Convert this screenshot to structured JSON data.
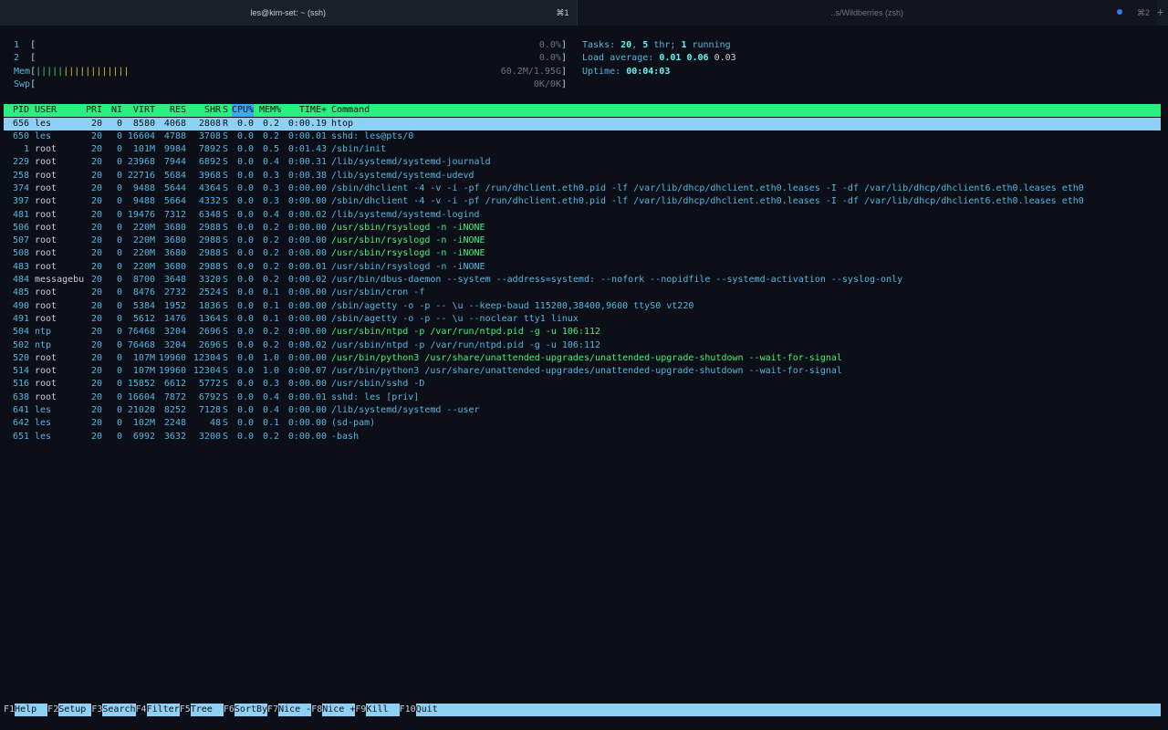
{
  "window": {
    "tabs": [
      {
        "title": "les@kim-set: ~ (ssh)",
        "shortcut": "⌘1"
      },
      {
        "title": "..s/Wildberries (zsh)",
        "shortcut": "⌘2"
      }
    ],
    "new_tab": "+"
  },
  "meters": {
    "cpu1": {
      "label": "1",
      "open": "[",
      "bar": "",
      "value": "0.0%",
      "close": "]"
    },
    "cpu2": {
      "label": "2",
      "open": "[",
      "bar": "",
      "value": "0.0%",
      "close": "]"
    },
    "mem": {
      "label": "Mem",
      "open": "[",
      "bar_green": "|||||",
      "bar_yellow": "||||||||||||",
      "value": "60.2M/1.95G",
      "close": "]"
    },
    "swp": {
      "label": "Swp",
      "open": "[",
      "bar": "",
      "value": "0K/0K",
      "close": "]"
    }
  },
  "stats": {
    "tasks_label": "Tasks:",
    "tasks": "20",
    "thr": "5",
    "thr_label": "thr;",
    "running": "1",
    "running_label": "running",
    "load_label": "Load average:",
    "load1": "0.01",
    "load5": "0.06",
    "load15": "0.03",
    "uptime_label": "Uptime:",
    "uptime": "00:04:03"
  },
  "columns": {
    "pid": "PID",
    "user": "USER",
    "pri": "PRI",
    "ni": "NI",
    "virt": "VIRT",
    "res": "RES",
    "shr": "SHR",
    "s": "S",
    "cpu": "CPU%",
    "mem": "MEM%",
    "time": "TIME+",
    "cmd": "Command"
  },
  "processes": [
    {
      "pid": "656",
      "user": "les",
      "pri": "20",
      "ni": "0",
      "virt": "8580",
      "res": "4068",
      "shr": "2808",
      "s": "R",
      "cpu": "0.0",
      "mem": "0.2",
      "time": "0:00.19",
      "cmd": "htop",
      "style": "selected"
    },
    {
      "pid": "650",
      "user": "les",
      "pri": "20",
      "ni": "0",
      "virt": "16604",
      "res": "4788",
      "shr": "3708",
      "s": "S",
      "cpu": "0.0",
      "mem": "0.2",
      "time": "0:00.01",
      "cmd": "sshd: les@pts/0",
      "style": "normal"
    },
    {
      "pid": "1",
      "user": "root",
      "pri": "20",
      "ni": "0",
      "virt": "101M",
      "res": "9984",
      "shr": "7892",
      "s": "S",
      "cpu": "0.0",
      "mem": "0.5",
      "time": "0:01.43",
      "cmd": "/sbin/init",
      "style": "normal"
    },
    {
      "pid": "229",
      "user": "root",
      "pri": "20",
      "ni": "0",
      "virt": "23968",
      "res": "7944",
      "shr": "6892",
      "s": "S",
      "cpu": "0.0",
      "mem": "0.4",
      "time": "0:00.31",
      "cmd": "/lib/systemd/systemd-journald",
      "style": "normal"
    },
    {
      "pid": "258",
      "user": "root",
      "pri": "20",
      "ni": "0",
      "virt": "22716",
      "res": "5684",
      "shr": "3968",
      "s": "S",
      "cpu": "0.0",
      "mem": "0.3",
      "time": "0:00.38",
      "cmd": "/lib/systemd/systemd-udevd",
      "style": "normal"
    },
    {
      "pid": "374",
      "user": "root",
      "pri": "20",
      "ni": "0",
      "virt": "9488",
      "res": "5644",
      "shr": "4364",
      "s": "S",
      "cpu": "0.0",
      "mem": "0.3",
      "time": "0:00.00",
      "cmd": "/sbin/dhclient -4 -v -i -pf /run/dhclient.eth0.pid -lf /var/lib/dhcp/dhclient.eth0.leases -I -df /var/lib/dhcp/dhclient6.eth0.leases eth0",
      "style": "normal"
    },
    {
      "pid": "397",
      "user": "root",
      "pri": "20",
      "ni": "0",
      "virt": "9488",
      "res": "5664",
      "shr": "4332",
      "s": "S",
      "cpu": "0.0",
      "mem": "0.3",
      "time": "0:00.00",
      "cmd": "/sbin/dhclient -4 -v -i -pf /run/dhclient.eth0.pid -lf /var/lib/dhcp/dhclient.eth0.leases -I -df /var/lib/dhcp/dhclient6.eth0.leases eth0",
      "style": "normal"
    },
    {
      "pid": "481",
      "user": "root",
      "pri": "20",
      "ni": "0",
      "virt": "19476",
      "res": "7312",
      "shr": "6348",
      "s": "S",
      "cpu": "0.0",
      "mem": "0.4",
      "time": "0:00.02",
      "cmd": "/lib/systemd/systemd-logind",
      "style": "normal"
    },
    {
      "pid": "506",
      "user": "root",
      "pri": "20",
      "ni": "0",
      "virt": "220M",
      "res": "3680",
      "shr": "2988",
      "s": "S",
      "cpu": "0.0",
      "mem": "0.2",
      "time": "0:00.00",
      "cmd": "/usr/sbin/rsyslogd -n -iNONE",
      "style": "thread"
    },
    {
      "pid": "507",
      "user": "root",
      "pri": "20",
      "ni": "0",
      "virt": "220M",
      "res": "3680",
      "shr": "2988",
      "s": "S",
      "cpu": "0.0",
      "mem": "0.2",
      "time": "0:00.00",
      "cmd": "/usr/sbin/rsyslogd -n -iNONE",
      "style": "thread"
    },
    {
      "pid": "508",
      "user": "root",
      "pri": "20",
      "ni": "0",
      "virt": "220M",
      "res": "3680",
      "shr": "2988",
      "s": "S",
      "cpu": "0.0",
      "mem": "0.2",
      "time": "0:00.00",
      "cmd": "/usr/sbin/rsyslogd -n -iNONE",
      "style": "thread"
    },
    {
      "pid": "483",
      "user": "root",
      "pri": "20",
      "ni": "0",
      "virt": "220M",
      "res": "3680",
      "shr": "2988",
      "s": "S",
      "cpu": "0.0",
      "mem": "0.2",
      "time": "0:00.01",
      "cmd": "/usr/sbin/rsyslogd -n -iNONE",
      "style": "normal"
    },
    {
      "pid": "484",
      "user": "messagebu",
      "pri": "20",
      "ni": "0",
      "virt": "8700",
      "res": "3648",
      "shr": "3320",
      "s": "S",
      "cpu": "0.0",
      "mem": "0.2",
      "time": "0:00.02",
      "cmd": "/usr/bin/dbus-daemon --system --address=systemd: --nofork --nopidfile --systemd-activation --syslog-only",
      "style": "normal"
    },
    {
      "pid": "485",
      "user": "root",
      "pri": "20",
      "ni": "0",
      "virt": "8476",
      "res": "2732",
      "shr": "2524",
      "s": "S",
      "cpu": "0.0",
      "mem": "0.1",
      "time": "0:00.00",
      "cmd": "/usr/sbin/cron -f",
      "style": "normal"
    },
    {
      "pid": "490",
      "user": "root",
      "pri": "20",
      "ni": "0",
      "virt": "5384",
      "res": "1952",
      "shr": "1836",
      "s": "S",
      "cpu": "0.0",
      "mem": "0.1",
      "time": "0:00.00",
      "cmd": "/sbin/agetty -o -p -- \\u --keep-baud 115200,38400,9600 ttyS0 vt220",
      "style": "normal"
    },
    {
      "pid": "491",
      "user": "root",
      "pri": "20",
      "ni": "0",
      "virt": "5612",
      "res": "1476",
      "shr": "1364",
      "s": "S",
      "cpu": "0.0",
      "mem": "0.1",
      "time": "0:00.00",
      "cmd": "/sbin/agetty -o -p -- \\u --noclear tty1 linux",
      "style": "normal"
    },
    {
      "pid": "504",
      "user": "ntp",
      "pri": "20",
      "ni": "0",
      "virt": "76468",
      "res": "3204",
      "shr": "2696",
      "s": "S",
      "cpu": "0.0",
      "mem": "0.2",
      "time": "0:00.00",
      "cmd": "/usr/sbin/ntpd -p /var/run/ntpd.pid -g -u 106:112",
      "style": "thread"
    },
    {
      "pid": "502",
      "user": "ntp",
      "pri": "20",
      "ni": "0",
      "virt": "76468",
      "res": "3204",
      "shr": "2696",
      "s": "S",
      "cpu": "0.0",
      "mem": "0.2",
      "time": "0:00.02",
      "cmd": "/usr/sbin/ntpd -p /var/run/ntpd.pid -g -u 106:112",
      "style": "normal"
    },
    {
      "pid": "520",
      "user": "root",
      "pri": "20",
      "ni": "0",
      "virt": "107M",
      "res": "19960",
      "shr": "12304",
      "s": "S",
      "cpu": "0.0",
      "mem": "1.0",
      "time": "0:00.00",
      "cmd": "/usr/bin/python3 /usr/share/unattended-upgrades/unattended-upgrade-shutdown --wait-for-signal",
      "style": "thread"
    },
    {
      "pid": "514",
      "user": "root",
      "pri": "20",
      "ni": "0",
      "virt": "107M",
      "res": "19960",
      "shr": "12304",
      "s": "S",
      "cpu": "0.0",
      "mem": "1.0",
      "time": "0:00.07",
      "cmd": "/usr/bin/python3 /usr/share/unattended-upgrades/unattended-upgrade-shutdown --wait-for-signal",
      "style": "normal"
    },
    {
      "pid": "516",
      "user": "root",
      "pri": "20",
      "ni": "0",
      "virt": "15852",
      "res": "6612",
      "shr": "5772",
      "s": "S",
      "cpu": "0.0",
      "mem": "0.3",
      "time": "0:00.00",
      "cmd": "/usr/sbin/sshd -D",
      "style": "normal"
    },
    {
      "pid": "638",
      "user": "root",
      "pri": "20",
      "ni": "0",
      "virt": "16604",
      "res": "7872",
      "shr": "6792",
      "s": "S",
      "cpu": "0.0",
      "mem": "0.4",
      "time": "0:00.01",
      "cmd": "sshd: les [priv]",
      "style": "normal"
    },
    {
      "pid": "641",
      "user": "les",
      "pri": "20",
      "ni": "0",
      "virt": "21028",
      "res": "8252",
      "shr": "7128",
      "s": "S",
      "cpu": "0.0",
      "mem": "0.4",
      "time": "0:00.00",
      "cmd": "/lib/systemd/systemd --user",
      "style": "normal"
    },
    {
      "pid": "642",
      "user": "les",
      "pri": "20",
      "ni": "0",
      "virt": "102M",
      "res": "2248",
      "shr": "48",
      "s": "S",
      "cpu": "0.0",
      "mem": "0.1",
      "time": "0:00.00",
      "cmd": "(sd-pam)",
      "style": "normal"
    },
    {
      "pid": "651",
      "user": "les",
      "pri": "20",
      "ni": "0",
      "virt": "6992",
      "res": "3632",
      "shr": "3200",
      "s": "S",
      "cpu": "0.0",
      "mem": "0.2",
      "time": "0:00.00",
      "cmd": "-bash",
      "style": "normal"
    }
  ],
  "footer": [
    {
      "key": "F1",
      "label": "Help  "
    },
    {
      "key": "F2",
      "label": "Setup "
    },
    {
      "key": "F3",
      "label": "Search"
    },
    {
      "key": "F4",
      "label": "Filter"
    },
    {
      "key": "F5",
      "label": "Tree  "
    },
    {
      "key": "F6",
      "label": "SortBy"
    },
    {
      "key": "F7",
      "label": "Nice -"
    },
    {
      "key": "F8",
      "label": "Nice +"
    },
    {
      "key": "F9",
      "label": "Kill  "
    },
    {
      "key": "F10",
      "label": "Quit"
    }
  ],
  "colors": {
    "background": "#0c0f17",
    "header_bar": "#2af07f",
    "selected_row": "#8fd1f5",
    "text_cyan": "#56b6e0",
    "thread_green": "#3ff37a",
    "tab_dot": "#3e78f0"
  }
}
